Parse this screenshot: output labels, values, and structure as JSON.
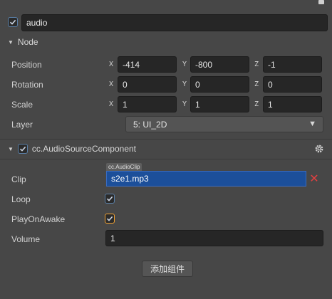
{
  "node_name": "audio",
  "node_section": {
    "title": "Node",
    "position": {
      "label": "Position",
      "x": "-414",
      "y": "-800",
      "z": "-1"
    },
    "rotation": {
      "label": "Rotation",
      "x": "0",
      "y": "0",
      "z": "0"
    },
    "scale": {
      "label": "Scale",
      "x": "1",
      "y": "1",
      "z": "1"
    },
    "layer": {
      "label": "Layer",
      "value": "5: UI_2D"
    }
  },
  "axes": {
    "x": "X",
    "y": "Y",
    "z": "Z"
  },
  "component": {
    "title": "cc.AudioSourceComponent",
    "clip": {
      "label": "Clip",
      "asset_type": "cc.AudioClip",
      "value": "s2e1.mp3"
    },
    "loop": {
      "label": "Loop",
      "checked": true
    },
    "play_on_awake": {
      "label": "PlayOnAwake",
      "checked": true
    },
    "volume": {
      "label": "Volume",
      "value": "1"
    }
  },
  "add_component_label": "添加组件",
  "icons": {
    "toggle": "triangle-down",
    "gear": "gear-icon",
    "remove": "cross-icon",
    "dropdown": "triangle-down"
  },
  "colors": {
    "background": "#474747",
    "input": "#262626",
    "clip_selected": "#1c4f9a",
    "remove": "#e04040",
    "focus": "#f0a030"
  }
}
